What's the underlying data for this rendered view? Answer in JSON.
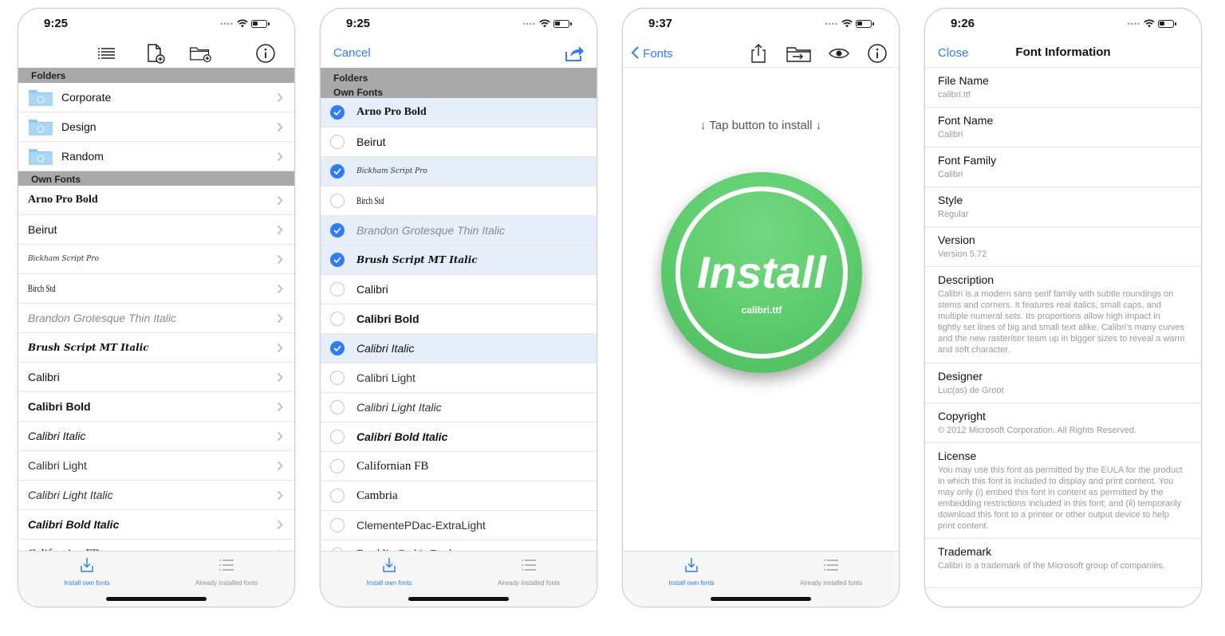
{
  "colors": {
    "accent": "#2f7cf6",
    "install_green": "#5ccb6c",
    "section_gray": "#a9a9a9",
    "selected_row": "#e6eef9"
  },
  "tabs": {
    "install": "Install own fonts",
    "installed": "Already installed fonts"
  },
  "screen1": {
    "time": "9:25",
    "icons": [
      "list-icon",
      "new-file-icon",
      "new-folder-icon",
      "info-icon"
    ],
    "folders_header": "Folders",
    "folders": [
      "Corporate",
      "Design",
      "Random"
    ],
    "own_header": "Own Fonts",
    "fonts": [
      "Arno Pro Bold",
      "Beirut",
      "Bickham Script Pro",
      "Birch Std",
      "Brandon Grotesque Thin Italic",
      "Brush Script MT Italic",
      "Calibri",
      "Calibri Bold",
      "Calibri Italic",
      "Calibri Light",
      "Calibri Light Italic",
      "Calibri Bold Italic",
      "Californian FB"
    ]
  },
  "screen2": {
    "time": "9:25",
    "cancel": "Cancel",
    "folders_header": "Folders",
    "own_header": "Own Fonts",
    "fonts": [
      {
        "name": "Arno Pro Bold",
        "checked": true
      },
      {
        "name": "Beirut",
        "checked": false
      },
      {
        "name": "Bickham Script Pro",
        "checked": true
      },
      {
        "name": "Birch Std",
        "checked": false
      },
      {
        "name": "Brandon Grotesque Thin Italic",
        "checked": true
      },
      {
        "name": "Brush Script MT Italic",
        "checked": true
      },
      {
        "name": "Calibri",
        "checked": false
      },
      {
        "name": "Calibri Bold",
        "checked": false
      },
      {
        "name": "Calibri Italic",
        "checked": true
      },
      {
        "name": "Calibri Light",
        "checked": false
      },
      {
        "name": "Calibri Light Italic",
        "checked": false
      },
      {
        "name": "Calibri Bold Italic",
        "checked": false
      },
      {
        "name": "Californian FB",
        "checked": false
      },
      {
        "name": "Cambria",
        "checked": false
      },
      {
        "name": "ClementePDac-ExtraLight",
        "checked": false
      },
      {
        "name": "Franklin Gothic Book",
        "checked": false
      }
    ]
  },
  "screen3": {
    "time": "9:37",
    "back": "Fonts",
    "hint": "↓ Tap button to install ↓",
    "install": "Install",
    "file": "calibri.ttf"
  },
  "screen4": {
    "time": "9:26",
    "close": "Close",
    "title": "Font Information",
    "items": [
      {
        "k": "File Name",
        "v": "calibri.ttf"
      },
      {
        "k": "Font Name",
        "v": "Calibri"
      },
      {
        "k": "Font Family",
        "v": "Calibri"
      },
      {
        "k": "Style",
        "v": "Regular"
      },
      {
        "k": "Version",
        "v": "Version 5.72"
      },
      {
        "k": "Description",
        "v": "Calibri is a modern sans serif family with subtle roundings on stems and corners. It features real italics, small caps, and multiple numeral sets. Its proportions allow high impact in tightly set lines of big and small text alike. Calibri's many curves and the new rasteriser team up in bigger sizes to reveal a warm and soft character."
      },
      {
        "k": "Designer",
        "v": "Luc(as) de Groot"
      },
      {
        "k": "Copyright",
        "v": "© 2012 Microsoft Corporation. All Rights Reserved."
      },
      {
        "k": "License",
        "v": "You may use this font as permitted by the EULA for the product in which this font is included to display and print content. You may only (i) embed this font in content as permitted by the embedding restrictions included in this font; and (ii) temporarily download this font to a printer or other output device to help print content."
      },
      {
        "k": "Trademark",
        "v": "Calibri is a trademark of the Microsoft group of companies."
      }
    ]
  }
}
